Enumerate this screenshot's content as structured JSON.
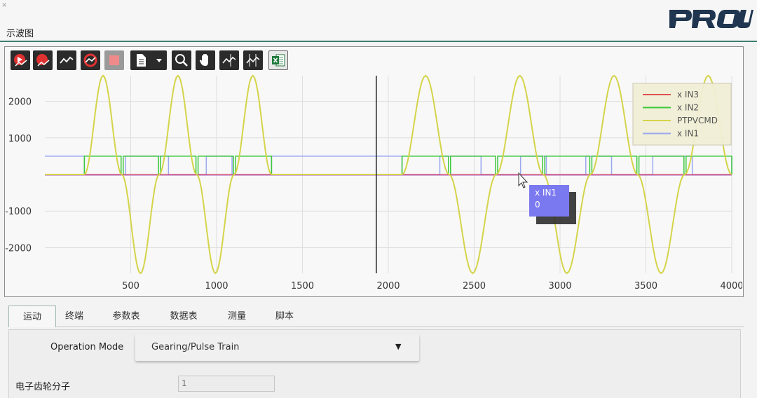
{
  "panel_title": "示波图",
  "brand": "PROU",
  "toolbar": {
    "buttons": [
      {
        "name": "run-record-icon",
        "color": "#e03131"
      },
      {
        "name": "single-record-icon",
        "color": "#e03131"
      },
      {
        "name": "roll-mode-icon",
        "color": "#ffffff"
      },
      {
        "name": "refresh-cycle-icon",
        "color": "#e03131"
      },
      {
        "name": "stop-icon",
        "color": "#f08a8a"
      },
      {
        "name": "file-menu-icon",
        "color": "#ffffff"
      },
      {
        "name": "zoom-icon",
        "color": "#ffffff"
      },
      {
        "name": "pan-hand-icon",
        "color": "#ffffff"
      },
      {
        "name": "cursor-measure-icon",
        "color": "#ffffff"
      },
      {
        "name": "dual-cursor-icon",
        "color": "#ffffff"
      },
      {
        "name": "excel-export-icon",
        "color": "#1f7a3a"
      }
    ]
  },
  "chart_data": {
    "type": "line",
    "x_ticks": [
      500,
      1000,
      1500,
      2000,
      2500,
      3000,
      3500,
      4000
    ],
    "y_ticks": [
      2000,
      1000,
      -1000,
      -2000
    ],
    "xlim": [
      0,
      4000
    ],
    "ylim": [
      -2700,
      2700
    ],
    "grid": true,
    "legend_position": "top-right",
    "cursor_x": 1930,
    "series": [
      {
        "name": "x IN3",
        "color": "#e05050"
      },
      {
        "name": "x IN2",
        "color": "#3cc83c"
      },
      {
        "name": "PTPVCMD",
        "color": "#d4d44a"
      },
      {
        "name": "x IN1",
        "color": "#9aa8f0"
      }
    ],
    "ptpvcmd_bursts": [
      [
        230,
        1320,
        [
          2700,
          -2700,
          2700,
          -2700,
          2700
        ]
      ],
      [
        2080,
        4000,
        [
          2700,
          -2700,
          2700,
          -2700,
          2700,
          -2700,
          2700
        ]
      ]
    ],
    "pulse_level": 500,
    "in1_edges": [
      230,
      470,
      720,
      940,
      1090,
      1320,
      2080,
      2300,
      2540,
      2770,
      2920,
      3150,
      3300,
      3540,
      3770,
      4000
    ],
    "tooltip": {
      "series": "x IN1",
      "value": "0"
    }
  },
  "tabs": [
    "运动",
    "终端",
    "参数表",
    "数据表",
    "测量",
    "脚本"
  ],
  "operation_mode": {
    "label": "Operation Mode",
    "value": "Gearing/Pulse Train"
  },
  "gear_numerator": {
    "label": "电子齿轮分子",
    "value": "1"
  }
}
